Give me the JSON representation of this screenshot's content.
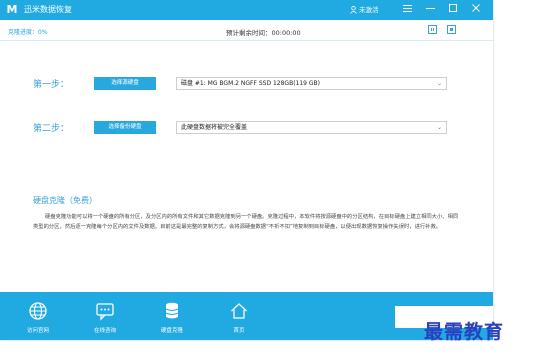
{
  "titlebar": {
    "logo_letter": "M",
    "title": "迅米数据恢复",
    "user_label": "未激活",
    "menu_icon": "hamburger-icon",
    "minimize_icon": "minimize-icon",
    "maximize_icon": "maximize-icon",
    "close_icon": "close-icon"
  },
  "progress": {
    "label": "克隆进度：0%",
    "time_label": "预计剩余时间：00:00:00"
  },
  "steps": [
    {
      "label": "第一步：",
      "button": "选择源硬盘",
      "select_value": "磁盘 #1: MG BGM.2 NGFF SSD 128GB(119 GB)"
    },
    {
      "label": "第二步：",
      "button": "选择备份硬盘",
      "select_value": "此硬盘数据将被完全覆盖"
    }
  ],
  "description": {
    "title": "硬盘克隆（免费）",
    "text": "硬盘克隆功能可以将一个硬盘的所有分区，及分区内的所有文件和其它数据克隆到另一个硬盘。克隆过程中，本软件将按源硬盘中的分区结构，在目标硬盘上建立相同大小、相同类型的分区，然后逐一克隆每个分区内的文件及数据。目前这是最完整的复制方式，会将源硬盘数据“不折不扣”地复制到目标硬盘，以便出现数据恢复操作失误时，进行补救。"
  },
  "bottom_nav": [
    {
      "icon": "globe-icon",
      "label": "访问官网"
    },
    {
      "icon": "chat-icon",
      "label": "在线咨询"
    },
    {
      "icon": "disk-icon",
      "label": "硬盘克隆"
    },
    {
      "icon": "home-icon",
      "label": "首页"
    }
  ],
  "watermark": "最需教育",
  "colors": {
    "accent": "#21a9e1",
    "label_blue": "#3aa0d8",
    "watermark": "#2a3fc0"
  }
}
